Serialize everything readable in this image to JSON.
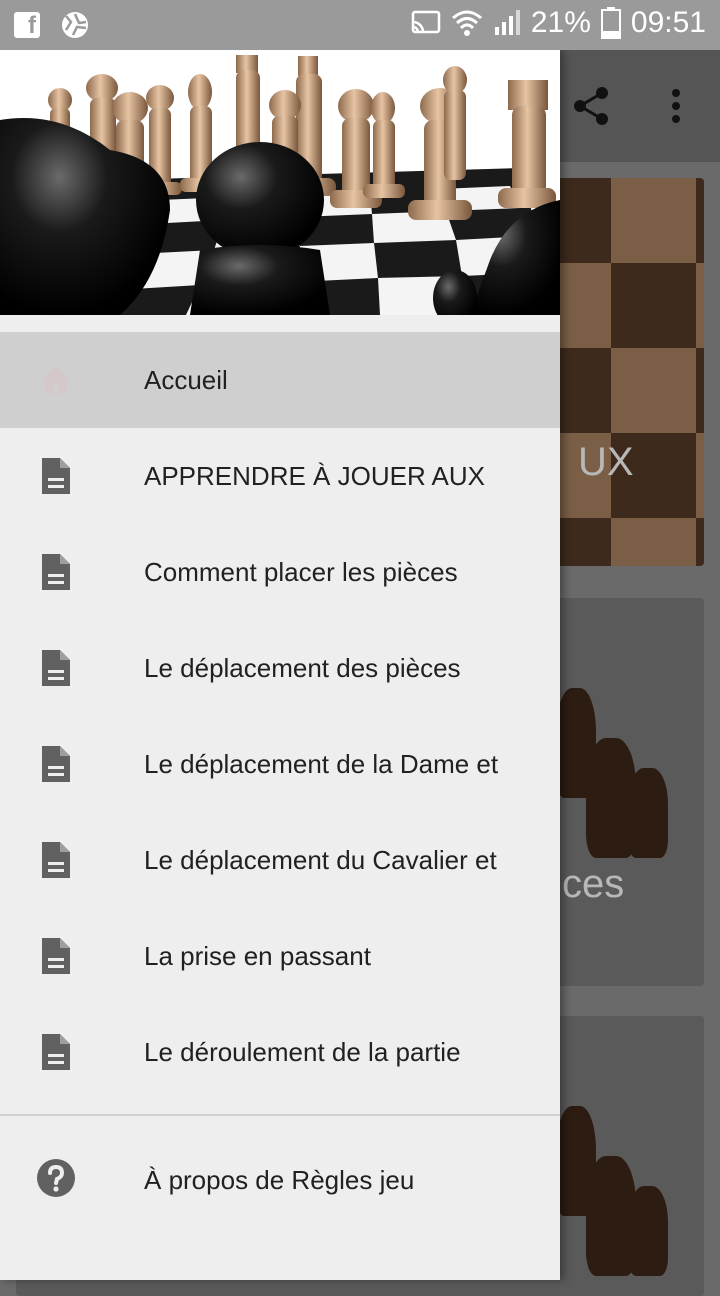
{
  "status_bar": {
    "battery": "21%",
    "time": "09:51",
    "icons": [
      "facebook-icon",
      "aperture-icon",
      "cast-icon",
      "wifi-icon",
      "signal-icon",
      "battery-icon"
    ]
  },
  "background_app": {
    "card1_title_fragment": "UX",
    "card2_title_fragment": "ces",
    "icons": [
      "share-icon",
      "more-vert-icon"
    ]
  },
  "drawer": {
    "items": [
      {
        "label": "Accueil",
        "icon": "home-icon",
        "active": true
      },
      {
        "label": "APPRENDRE À JOUER AUX",
        "icon": "document-icon",
        "active": false
      },
      {
        "label": "Comment placer les pièces",
        "icon": "document-icon",
        "active": false
      },
      {
        "label": "Le déplacement des pièces",
        "icon": "document-icon",
        "active": false
      },
      {
        "label": "Le déplacement de la Dame et",
        "icon": "document-icon",
        "active": false
      },
      {
        "label": "Le déplacement du Cavalier et",
        "icon": "document-icon",
        "active": false
      },
      {
        "label": "La prise en passant",
        "icon": "document-icon",
        "active": false
      },
      {
        "label": "Le déroulement de la partie",
        "icon": "document-icon",
        "active": false
      }
    ],
    "footer_item": {
      "label": "À propos de Règles jeu",
      "icon": "help-icon"
    }
  },
  "colors": {
    "drawer_bg": "#eeeeee",
    "active_item_bg": "#cfcfcf",
    "icon_gray": "#616161",
    "status_bar": "#9a9a9a"
  }
}
